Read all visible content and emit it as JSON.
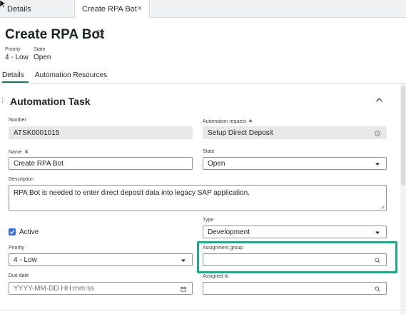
{
  "tabs": {
    "details_label": "Details",
    "create_label": "Create RPA Bot",
    "close_glyph": "×"
  },
  "header": {
    "title": "Create RPA Bot",
    "priority_label": "Priority",
    "priority_value": "4 - Low",
    "state_label": "State",
    "state_value": "Open"
  },
  "form_tabs": {
    "details": "Details",
    "automation_resources": "Automation Resources"
  },
  "section": {
    "title": "Automation Task"
  },
  "fields": {
    "number_label": "Number",
    "number_value": "ATSK0001015",
    "automation_request_label": "Automation request",
    "automation_request_value": "Setup Direct Deposit",
    "name_label": "Name",
    "name_value": "Create RPA Bot",
    "state_label": "State",
    "state_value": "Open",
    "description_label": "Description",
    "description_value": "RPA Bot is needed to enter direct deposit data into legacy SAP application.",
    "active_label": "Active",
    "active_checked": true,
    "type_label": "Type",
    "type_value": "Development",
    "priority_label": "Priority",
    "priority_value": "4 - Low",
    "assignment_group_label": "Assignment group",
    "assignment_group_value": "",
    "due_date_label": "Due date",
    "due_date_placeholder": "YYYY-MM-DD HH:mm:ss",
    "assigned_to_label": "Assigned to",
    "assigned_to_value": ""
  },
  "required_glyph": "∗",
  "colors": {
    "accent": "#2b6e63",
    "highlight": "#27a58d",
    "checkbox": "#3d6fd6"
  },
  "icons": {
    "tag": "tag-icon",
    "info": "info-icon",
    "dropdown": "chevron-down-icon",
    "search": "search-icon",
    "calendar": "calendar-icon",
    "collapse": "chevron-up-icon"
  }
}
